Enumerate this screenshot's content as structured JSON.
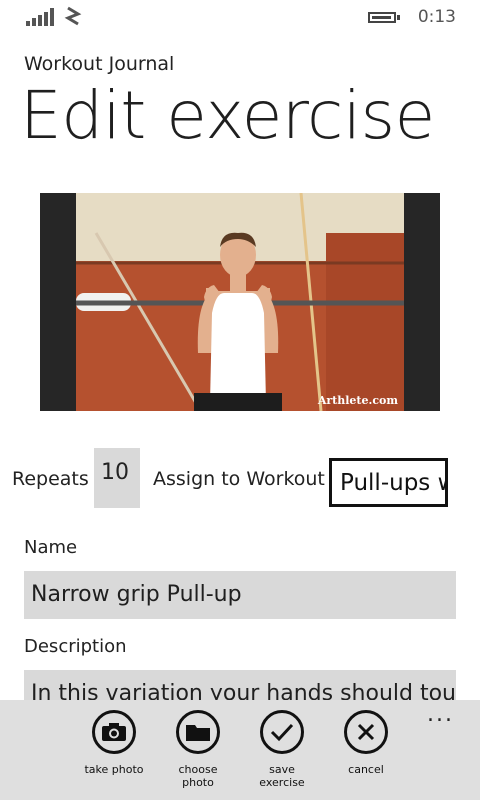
{
  "status": {
    "time": "0:13"
  },
  "header": {
    "app_title": "Workout Journal",
    "page_title": "Edit exercise"
  },
  "photo": {
    "watermark": "Arthlete.com"
  },
  "repeats": {
    "label": "Repeats",
    "value": "10"
  },
  "assign": {
    "label": "Assign to Workout",
    "value": "Pull-ups w"
  },
  "name": {
    "label": "Name",
    "value": "Narrow grip Pull-up"
  },
  "description": {
    "label": "Description",
    "value": "In this variation your hands should tou"
  },
  "appbar": {
    "more": "...",
    "buttons": [
      {
        "label": "take photo",
        "icon": "camera-icon"
      },
      {
        "label": "choose\nphoto",
        "icon": "folder-icon"
      },
      {
        "label": "save\nexercise",
        "icon": "check-icon"
      },
      {
        "label": "cancel",
        "icon": "close-icon"
      }
    ]
  }
}
